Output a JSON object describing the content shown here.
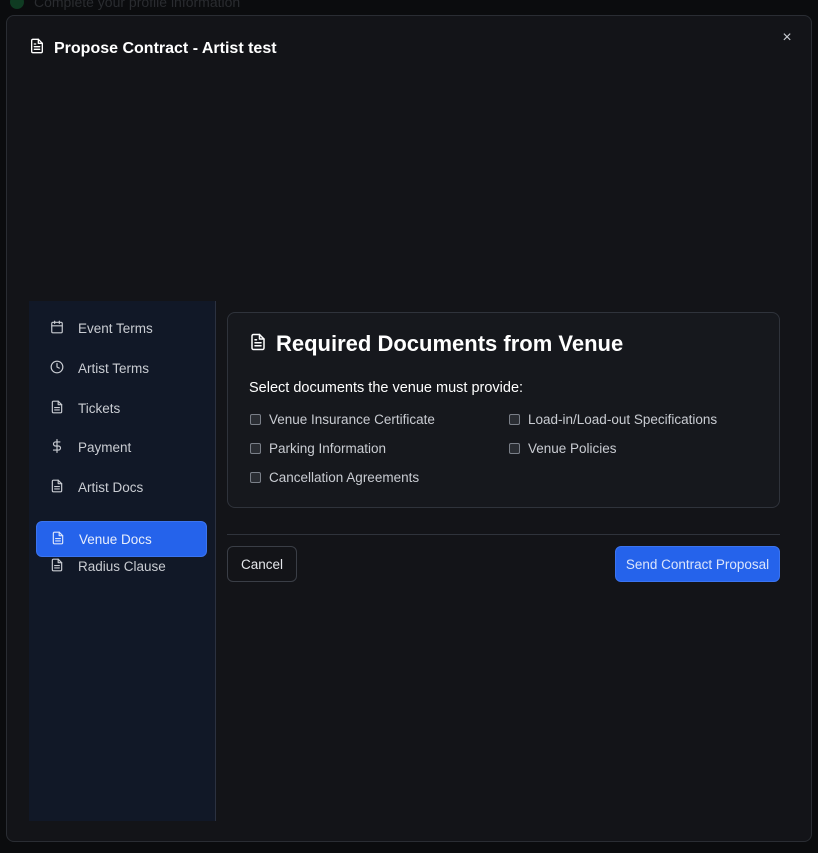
{
  "backdrop": {
    "text": "Complete your profile information"
  },
  "modal": {
    "title": "Propose Contract - Artist test",
    "close_label": "×"
  },
  "sidebar": {
    "items": [
      {
        "label": "Event Terms",
        "icon": "calendar-icon"
      },
      {
        "label": "Artist Terms",
        "icon": "clock-icon"
      },
      {
        "label": "Tickets",
        "icon": "document-icon"
      },
      {
        "label": "Payment",
        "icon": "dollar-icon"
      },
      {
        "label": "Artist Docs",
        "icon": "document-icon"
      },
      {
        "label": "Venue Docs",
        "icon": "document-icon",
        "active": true
      },
      {
        "label": "Radius Clause",
        "icon": "document-icon"
      }
    ]
  },
  "section": {
    "title": "Required Documents from Venue",
    "subtitle": "Select documents the venue must provide:",
    "documents": [
      {
        "label": "Venue Insurance Certificate",
        "checked": false
      },
      {
        "label": "Load-in/Load-out Specifications",
        "checked": false
      },
      {
        "label": "Parking Information",
        "checked": false
      },
      {
        "label": "Venue Policies",
        "checked": false
      },
      {
        "label": "Cancellation Agreements",
        "checked": false
      }
    ]
  },
  "footer": {
    "cancel_label": "Cancel",
    "send_label": "Send Contract Proposal"
  },
  "colors": {
    "accent": "#2563eb",
    "modal_bg": "#131418",
    "sidebar_bg": "#111827"
  }
}
